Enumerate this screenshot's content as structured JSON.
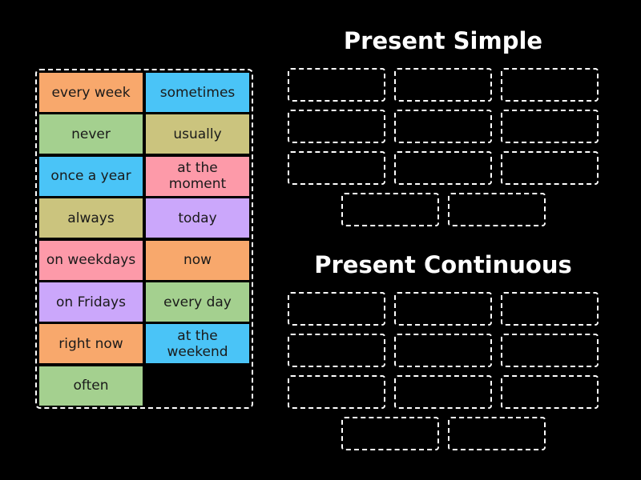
{
  "tiles": [
    {
      "label": "every week",
      "color": "#f8a86c"
    },
    {
      "label": "sometimes",
      "color": "#4ac4f7"
    },
    {
      "label": "never",
      "color": "#a4d08f"
    },
    {
      "label": "usually",
      "color": "#cbc47e"
    },
    {
      "label": "once a year",
      "color": "#4ac4f7"
    },
    {
      "label": "at the moment",
      "color": "#fd9aa9"
    },
    {
      "label": "always",
      "color": "#cbc47e"
    },
    {
      "label": "today",
      "color": "#cba7fb"
    },
    {
      "label": "on weekdays",
      "color": "#fd9aa9"
    },
    {
      "label": "now",
      "color": "#f8a86c"
    },
    {
      "label": "on Fridays",
      "color": "#cba7fb"
    },
    {
      "label": "every day",
      "color": "#a4d08f"
    },
    {
      "label": "right now",
      "color": "#f8a86c"
    },
    {
      "label": "at the weekend",
      "color": "#4ac4f7"
    },
    {
      "label": "often",
      "color": "#a4d08f"
    }
  ],
  "groups": [
    {
      "title": "Present Simple",
      "slots": 11
    },
    {
      "title": "Present Continuous",
      "slots": 11
    }
  ]
}
